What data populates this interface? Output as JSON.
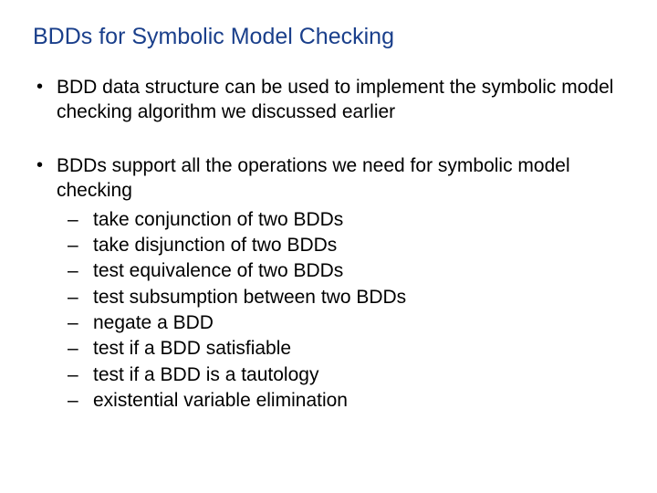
{
  "title": "BDDs for Symbolic Model Checking",
  "bullets": [
    {
      "text": "BDD data structure can be used to implement the symbolic model checking algorithm we discussed earlier"
    },
    {
      "text": "BDDs support all the operations we need for symbolic model checking",
      "sub": [
        "take conjunction of two BDDs",
        "take disjunction of two BDDs",
        "test equivalence of two BDDs",
        "test subsumption between two BDDs",
        "negate a BDD",
        "test if a BDD satisfiable",
        "test if a BDD is a tautology",
        "existential variable elimination"
      ]
    }
  ]
}
